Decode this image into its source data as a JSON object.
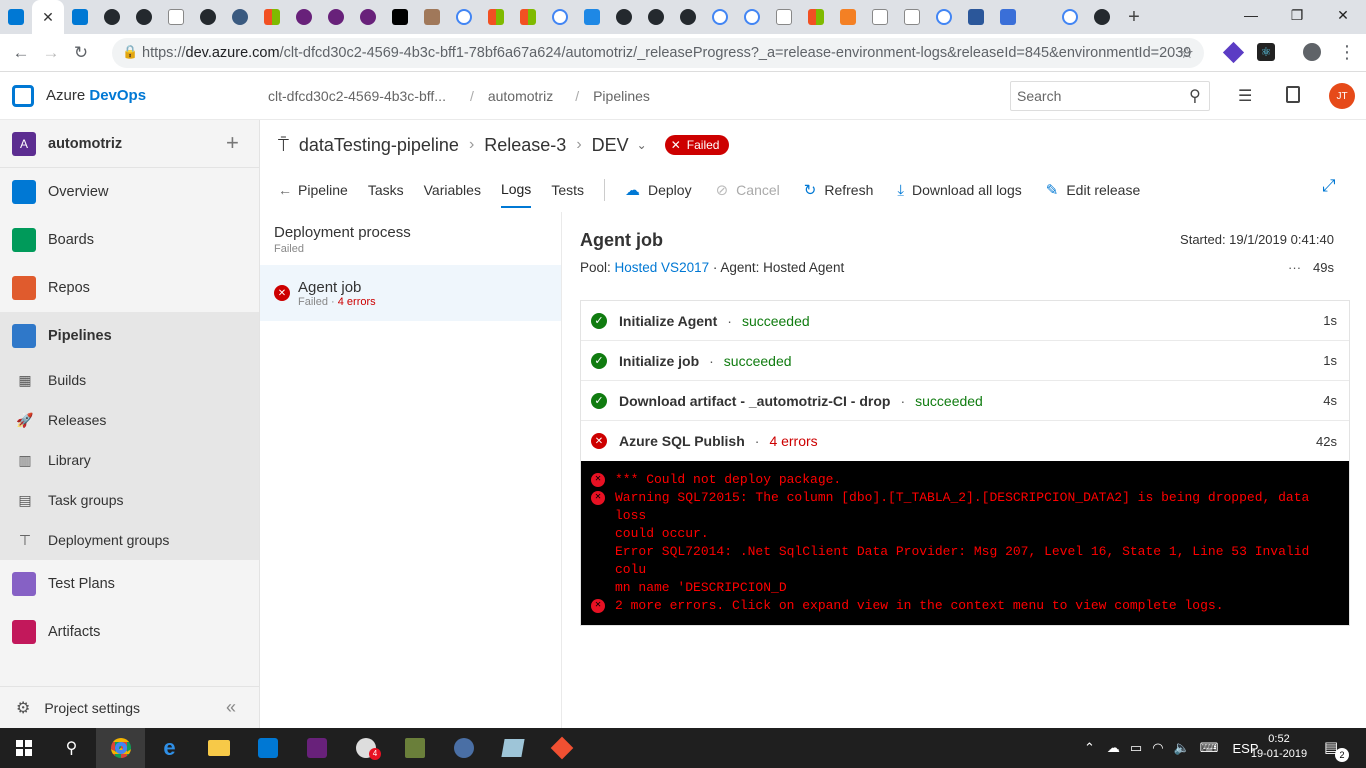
{
  "browser": {
    "url_prefix": "https://",
    "url_host": "dev.azure.com",
    "url_path": "/clt-dfcd30c2-4569-4b3c-bff1-78bf6a67a624/automotriz/_releaseProgress?_a=release-environment-logs&releaseId=845&environmentId=2039",
    "new_tab_label": "+"
  },
  "header": {
    "brand_azure": "Azure",
    "brand_devops": "DevOps",
    "breadcrumb_org": "clt-dfcd30c2-4569-4b3c-bff...",
    "breadcrumb_project": "automotriz",
    "breadcrumb_section": "Pipelines",
    "search_placeholder": "Search",
    "avatar_initials": "JT"
  },
  "sidebar": {
    "project_initial": "A",
    "project_name": "automotriz",
    "items": [
      {
        "label": "Overview",
        "color": "#0078d4"
      },
      {
        "label": "Boards",
        "color": "#009a5a"
      },
      {
        "label": "Repos",
        "color": "#e05b2d"
      },
      {
        "label": "Pipelines",
        "color": "#2f78c9"
      }
    ],
    "sub_items": [
      {
        "label": "Builds"
      },
      {
        "label": "Releases"
      },
      {
        "label": "Library"
      },
      {
        "label": "Task groups"
      },
      {
        "label": "Deployment groups"
      }
    ],
    "items_bottom": [
      {
        "label": "Test Plans",
        "color": "#8661c5"
      },
      {
        "label": "Artifacts",
        "color": "#c2185b"
      }
    ],
    "settings_label": "Project settings"
  },
  "release": {
    "pipeline_name": "dataTesting-pipeline",
    "release_name": "Release-3",
    "environment": "DEV",
    "status": "Failed"
  },
  "tabs": {
    "back": "Pipeline",
    "tasks": "Tasks",
    "variables": "Variables",
    "logs": "Logs",
    "tests": "Tests"
  },
  "commands": {
    "deploy": "Deploy",
    "cancel": "Cancel",
    "refresh": "Refresh",
    "download": "Download all logs",
    "edit": "Edit release"
  },
  "process": {
    "title": "Deployment process",
    "status": "Failed",
    "job_name": "Agent job",
    "job_status": "Failed · ",
    "job_errors": "4 errors"
  },
  "job": {
    "title": "Agent job",
    "started": "Started: 19/1/2019 0:41:40",
    "pool_label": "Pool: ",
    "pool_link": "Hosted VS2017",
    "agent": " · Agent: Hosted Agent",
    "duration": "49s",
    "steps": [
      {
        "name": "Initialize Agent",
        "result": "succeeded",
        "duration": "1s"
      },
      {
        "name": "Initialize job",
        "result": "succeeded",
        "duration": "1s"
      },
      {
        "name": "Download artifact - _automotriz-CI - drop",
        "result": "succeeded",
        "duration": "4s"
      },
      {
        "name": "Azure SQL Publish",
        "result": "4 errors",
        "duration": "42s"
      }
    ],
    "log_lines": [
      "*** Could not deploy package.",
      "Warning SQL72015: The column [dbo].[T_TABLA_2].[DESCRIPCION_DATA2] is being dropped, data loss",
      "could occur.",
      "Error SQL72014: .Net SqlClient Data Provider: Msg 207, Level 16, State 1, Line 53 Invalid colu",
      "mn name 'DESCRIPCION_D",
      "2 more errors. Click on expand view in the context menu to view complete logs."
    ]
  },
  "taskbar": {
    "lang": "ESP",
    "time": "0:52",
    "date": "19-01-2019",
    "notif_count": "2",
    "chrome_badge": "4"
  }
}
